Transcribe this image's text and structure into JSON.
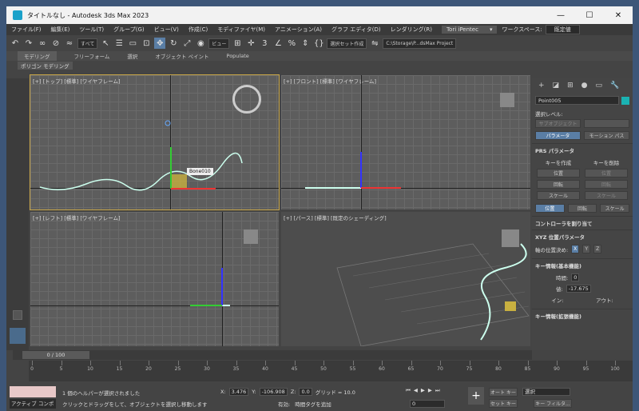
{
  "window": {
    "title": "タイトルなし - Autodesk 3ds Max 2023",
    "min": "—",
    "max": "☐",
    "close": "✕"
  },
  "menu": {
    "items": [
      "ファイル(F)",
      "編集(E)",
      "ツール(T)",
      "グループ(G)",
      "ビュー(V)",
      "作成(C)",
      "モディファイヤ(M)",
      "アニメーション(A)",
      "グラフ エディタ(D)",
      "レンダリング(R)"
    ],
    "user": "Tori iPentec",
    "workspace_label": "ワークスペース:",
    "workspace_value": "既定値"
  },
  "toolbar": {
    "filter": "すべて",
    "refcoord": "ビュー",
    "selset": "選択セット作成",
    "path": "C:\\Storage\\P...dsMax Project"
  },
  "ribbon": {
    "tabs": [
      "モデリング",
      "フリーフォーム",
      "選択",
      "オブジェクト ペイント",
      "Populate"
    ],
    "sub": "ポリゴン モデリング"
  },
  "viewports": {
    "top": "[+] [トップ] [標準] [ワイヤフレーム]",
    "front": "[+] [フロント] [標準] [ワイヤフレーム]",
    "left": "[+] [レフト] [標準] [ワイヤフレーム]",
    "persp": "[+] [パース] [標準] [既定のシェーディング]",
    "tooltip": "Bone010"
  },
  "command_panel": {
    "object_name": "Point005",
    "sel_level": "選択レベル:",
    "subobject": "サブオブジェクト",
    "params_btn": "パラメータ",
    "motion_path_btn": "モーション パス",
    "prs_title": "PRS パラメータ",
    "create_key": "キーを作成",
    "delete_key": "キーを削除",
    "position": "位置",
    "rotation": "回転",
    "scale": "スケール",
    "assign_controller": "コントローラを割り当て",
    "xyz_title": "XYZ 位置パラメータ",
    "axis_label": "軸の位置決め:",
    "axes": [
      "X",
      "Y",
      "Z"
    ],
    "key_info_basic": "キー情報(基本機能)",
    "time_label": "時間:",
    "time_val": "0",
    "value_label": "値:",
    "value_val": "-17.675",
    "in_label": "イン:",
    "out_label": "アウト:",
    "key_info_ext": "キー情報(拡張機能)"
  },
  "timeline": {
    "slider": "0 / 100",
    "ticks": [
      0,
      5,
      10,
      15,
      20,
      25,
      30,
      35,
      40,
      45,
      50,
      55,
      60,
      65,
      70,
      75,
      80,
      85,
      90,
      95,
      100
    ]
  },
  "status": {
    "listener": "アクティブ コンポ",
    "msg1": "1 個のヘルパーが選択されました",
    "msg2": "クリックとドラッグをして、オブジェクトを選択し移動します",
    "x_label": "X:",
    "x_val": "3.476",
    "y_label": "Y:",
    "y_val": "-106.908",
    "z_label": "Z:",
    "z_val": "0.0",
    "grid": "グリッド = 10.0",
    "enabled": "有効:",
    "add_tag": "時間タグを追加",
    "frame": "0",
    "autokey": "オート キー",
    "setkey": "セット キー",
    "selected": "選択",
    "key_filter": "キー フィルタ..."
  }
}
